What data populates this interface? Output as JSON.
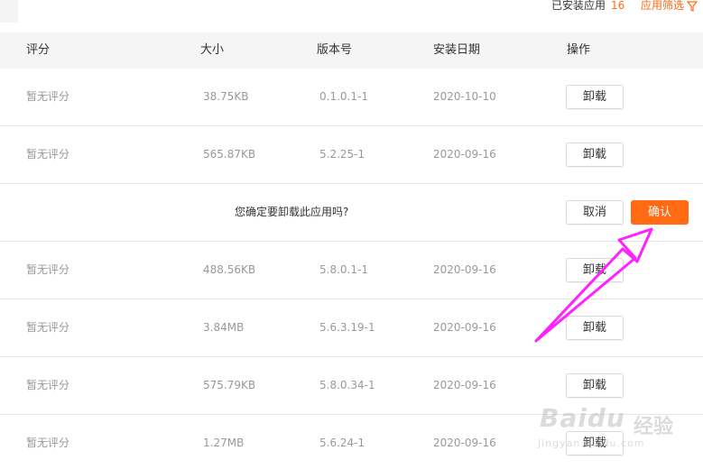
{
  "top": {
    "installed_label": "已安装应用",
    "installed_count": "16",
    "filter_label": "应用筛选"
  },
  "table": {
    "headers": [
      "评分",
      "大小",
      "版本号",
      "安装日期",
      "操作"
    ],
    "rows": [
      {
        "rating": "暂无评分",
        "size": "38.75KB",
        "version": "0.1.0.1-1",
        "date": "2020-10-10",
        "action": "卸载"
      },
      {
        "rating": "暂无评分",
        "size": "565.87KB",
        "version": "5.2.25-1",
        "date": "2020-09-16",
        "action": "卸载"
      },
      {
        "confirm_text": "您确定要卸载此应用吗?",
        "cancel": "取消",
        "confirm": "确认"
      },
      {
        "rating": "暂无评分",
        "size": "488.56KB",
        "version": "5.8.0.1-1",
        "date": "2020-09-16",
        "action": "卸载"
      },
      {
        "rating": "暂无评分",
        "size": "3.84MB",
        "version": "5.6.3.19-1",
        "date": "2020-09-16",
        "action": "卸载"
      },
      {
        "rating": "暂无评分",
        "size": "575.79KB",
        "version": "5.8.0.34-1",
        "date": "2020-09-16",
        "action": "卸载"
      },
      {
        "rating": "暂无评分",
        "size": "1.27MB",
        "version": "5.6.24-1",
        "date": "2020-09-16",
        "action": "卸载"
      }
    ]
  },
  "watermark": {
    "brand": "Baidu",
    "brand_cn": "经验",
    "url": "jingyan.baidu.com"
  },
  "colors": {
    "accent": "#ff6a13",
    "arrow": "#ff22ff"
  }
}
